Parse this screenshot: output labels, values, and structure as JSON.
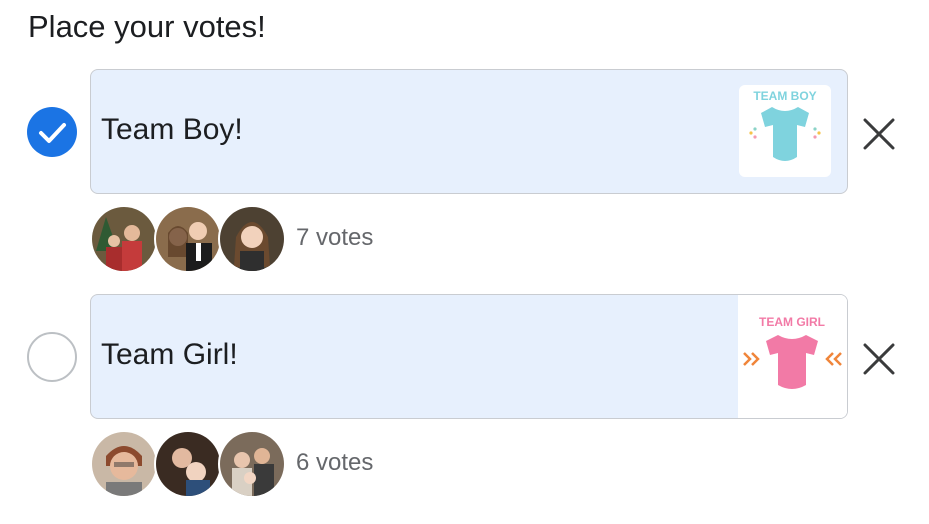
{
  "poll": {
    "heading": "Place your votes!",
    "options": [
      {
        "label": "Team Boy!",
        "selected": true,
        "image_text": "TEAM BOY",
        "image_color": "#7fd3de",
        "votes_text": "7 votes"
      },
      {
        "label": "Team Girl!",
        "selected": false,
        "image_text": "TEAM GIRL",
        "image_color": "#f27aa6",
        "votes_text": "6 votes"
      }
    ]
  },
  "colors": {
    "accent": "#1b74e4",
    "option_background": "#e7f0fd",
    "secondary_text": "#65676b"
  },
  "icons": {
    "selected": "check-circle-icon",
    "unselected": "empty-circle-icon",
    "remove": "close-icon"
  }
}
